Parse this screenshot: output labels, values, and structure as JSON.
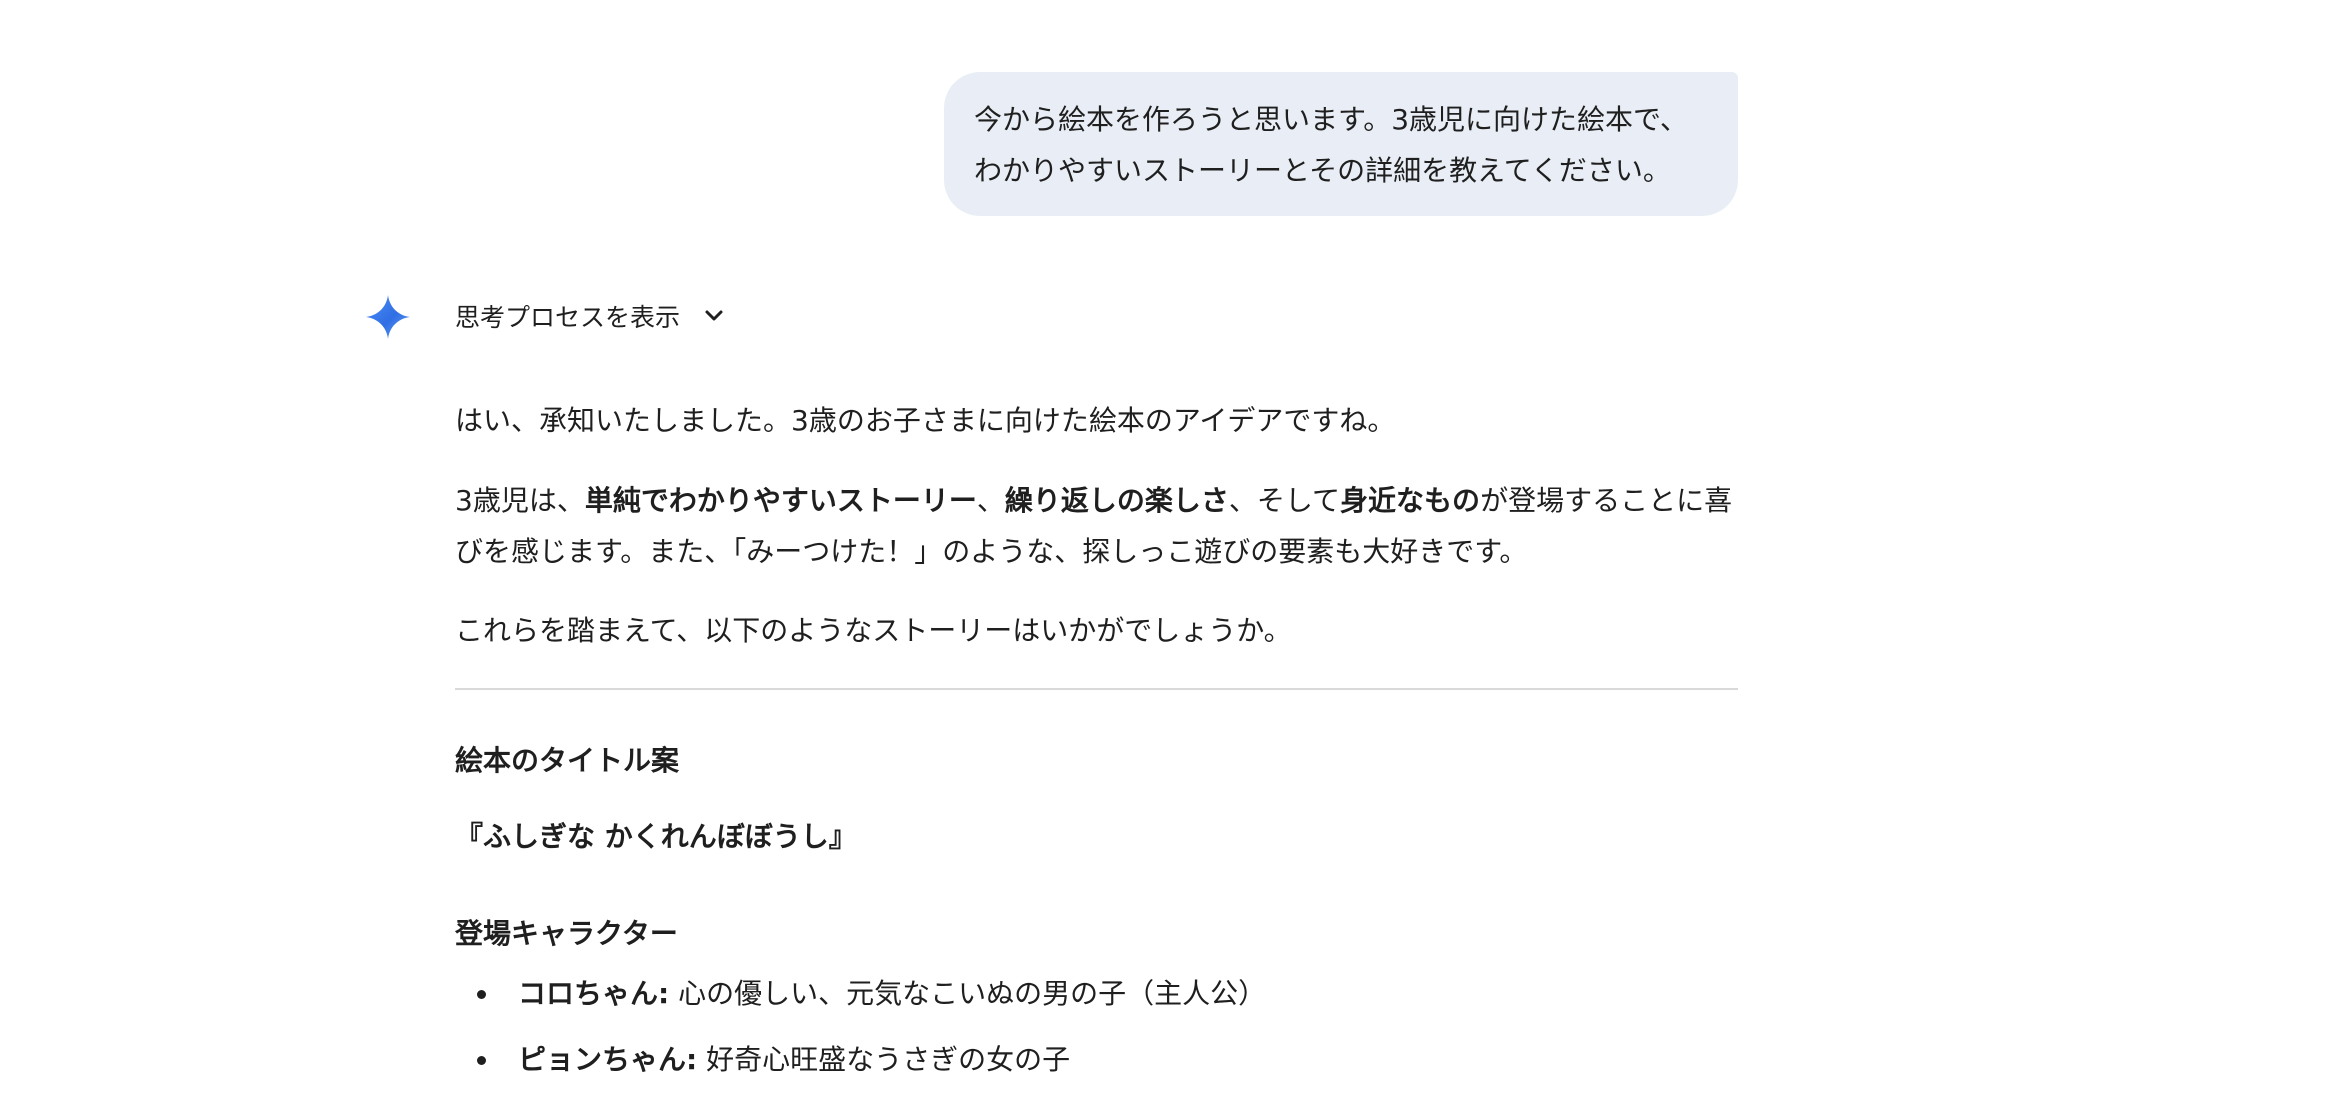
{
  "user_message": {
    "line1": "今から絵本を作ろうと思います。3歳児に向けた絵本で、",
    "line2": "わかりやすいストーリーとその詳細を教えてください。"
  },
  "model": {
    "icon": "gemini-sparkle-icon",
    "accent_colors": [
      "#4285f4",
      "#1a73e8",
      "#8ab4f8"
    ],
    "thoughts_toggle_label": "思考プロセスを表示",
    "toggle_icon": "chevron-down-icon"
  },
  "response": {
    "intro": "はい、承知いたしました。3歳のお子さまに向けた絵本のアイデアですね。",
    "p2": {
      "t1": "3歳児は、",
      "b1": "単純でわかりやすいストーリー",
      "t2": "、",
      "b2": "繰り返しの楽しさ",
      "t3": "、そして",
      "b3": "身近なもの",
      "t4": "が登場することに喜びを感じます。また、「みーつけた！」のような、探しっこ遊びの要素も大好きです。"
    },
    "p3": "これらを踏まえて、以下のようなストーリーはいかがでしょうか。",
    "title_heading": "絵本のタイトル案",
    "book_title": "『ふしぎな かくれんぼぼうし』",
    "characters_heading": "登場キャラクター",
    "characters": [
      {
        "name": "コロちゃん:",
        "desc": " 心の優しい、元気なこいぬの男の子（主人公）"
      },
      {
        "name": "ピョンちゃん:",
        "desc": " 好奇心旺盛なうさぎの女の子"
      }
    ]
  }
}
